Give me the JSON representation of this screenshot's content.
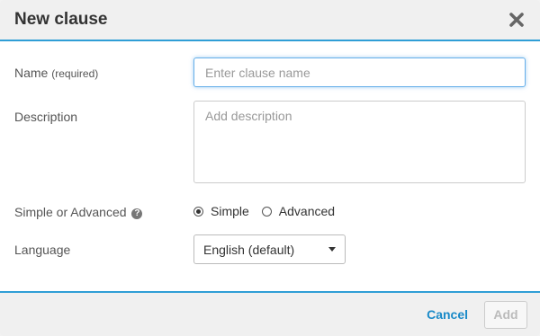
{
  "dialog": {
    "title": "New clause",
    "close_icon": "close-icon"
  },
  "form": {
    "name": {
      "label": "Name",
      "required_note": "(required)",
      "value": "",
      "placeholder": "Enter clause name"
    },
    "description": {
      "label": "Description",
      "value": "",
      "placeholder": "Add description"
    },
    "mode": {
      "label": "Simple or Advanced",
      "help_icon": "question-circle-icon",
      "options": [
        {
          "label": "Simple",
          "checked": true
        },
        {
          "label": "Advanced",
          "checked": false
        }
      ]
    },
    "language": {
      "label": "Language",
      "selected": "English (default)"
    }
  },
  "footer": {
    "cancel_label": "Cancel",
    "add_label": "Add"
  },
  "colors": {
    "accent": "#2f9ed6",
    "link": "#1a8ac8"
  }
}
